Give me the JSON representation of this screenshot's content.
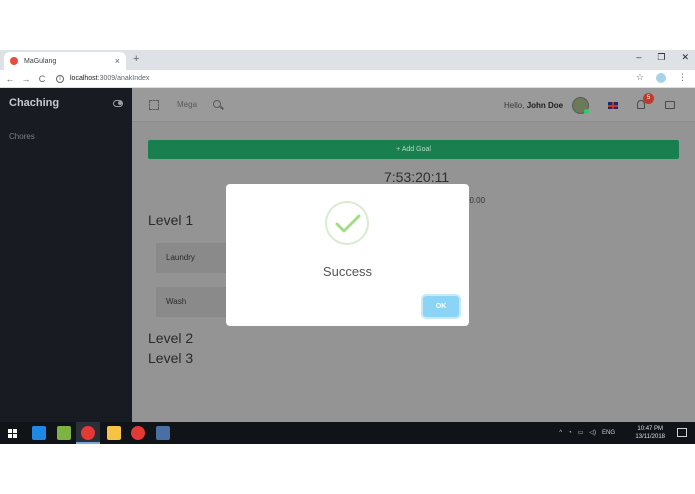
{
  "browser": {
    "tab_title": "MaGulang",
    "tab_close": "×",
    "new_tab": "+",
    "window_controls": [
      "–",
      "❐",
      "✕"
    ],
    "url_host": "localhost",
    "url_path": ":3009/anakIndex",
    "nav": [
      "←",
      "→",
      "C"
    ]
  },
  "sidebar": {
    "brand": "Chaching",
    "items": [
      {
        "label": "Chores"
      }
    ]
  },
  "topbar": {
    "mega_label": "Mega",
    "greeting": "Hello,",
    "user_name": "John Doe",
    "notification_count": "5"
  },
  "main": {
    "add_goal_label": "+ Add Goal",
    "timer": "7:53:20:11",
    "partial_value": "00.00",
    "levels": [
      {
        "title": "Level 1",
        "chores": [
          "Laundry",
          "Wash"
        ]
      },
      {
        "title": "Level 2"
      },
      {
        "title": "Level 3"
      }
    ]
  },
  "modal": {
    "title": "Success",
    "ok_label": "OK",
    "check_color": "#a5dc86"
  },
  "taskbar": {
    "tray_lang": "ENG",
    "time": "10:47 PM",
    "date": "13/11/2018"
  }
}
